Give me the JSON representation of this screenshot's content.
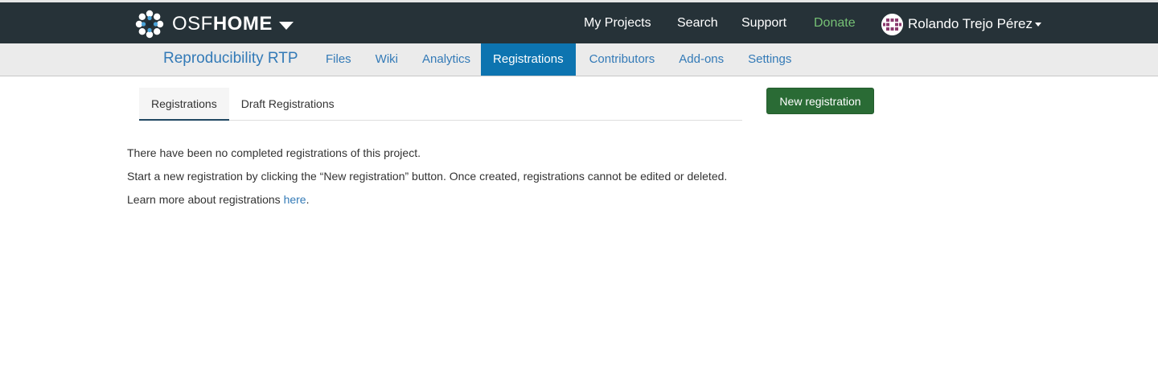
{
  "topbar": {
    "brand_osf": "OSF",
    "brand_home": "HOME",
    "nav": [
      {
        "label": "My Projects"
      },
      {
        "label": "Search"
      },
      {
        "label": "Support"
      },
      {
        "label": "Donate"
      }
    ],
    "user_name": "Rolando Trejo Pérez"
  },
  "project": {
    "title": "Reproducibility RTP",
    "nav": [
      {
        "label": "Files"
      },
      {
        "label": "Wiki"
      },
      {
        "label": "Analytics"
      },
      {
        "label": "Registrations"
      },
      {
        "label": "Contributors"
      },
      {
        "label": "Add-ons"
      },
      {
        "label": "Settings"
      }
    ]
  },
  "tabs": [
    {
      "label": "Registrations"
    },
    {
      "label": "Draft Registrations"
    }
  ],
  "new_registration_label": "New registration",
  "content": {
    "line1": "There have been no completed registrations of this project.",
    "line2": "Start a new registration by clicking the “New registration” button. Once created, registrations cannot be edited or deleted.",
    "line3_prefix": "Learn more about registrations ",
    "line3_link": "here",
    "line3_suffix": "."
  },
  "colors": {
    "topbar_bg": "#263238",
    "donate": "#76c175",
    "link": "#337ab7",
    "active_nav": "#0d74b0",
    "button_green": "#2a6b35"
  },
  "icons": [
    "osf-logo-icon",
    "chevron-down-icon",
    "avatar",
    "caret-down-icon"
  ]
}
